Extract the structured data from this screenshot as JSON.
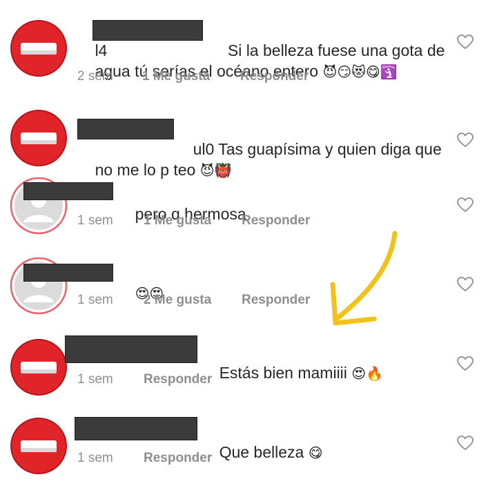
{
  "comments": [
    {
      "username_visible": "l4",
      "text_lines": [
        "Si la belleza fuese una gota de",
        "agua tú serías el océano entero"
      ],
      "emoji": "😈😏😻😋🛐",
      "time": "2 sem",
      "likes": "1 Me gusta",
      "reply": "Responder",
      "avatar": "no-entry-icon"
    },
    {
      "username_visible": "ul0",
      "text_lines": [
        "Tas guapísima y quien diga que",
        "no me lo p teo"
      ],
      "emoji": "😈👹",
      "avatar": "no-entry-icon"
    },
    {
      "text": "pero q hermosa",
      "time": "1 sem",
      "likes": "1 Me gusta",
      "reply": "Responder",
      "avatar": "default-user-avatar"
    },
    {
      "emoji": "😍😍",
      "time": "1 sem",
      "likes": "2 Me gusta",
      "reply": "Responder",
      "avatar": "default-user-avatar"
    },
    {
      "text": "Estás bien mamiiii",
      "emoji": "😍🔥",
      "time": "1 sem",
      "reply": "Responder",
      "avatar": "no-entry-icon"
    },
    {
      "text": "Que belleza",
      "emoji": "😋",
      "time": "1 sem",
      "reply": "Responder",
      "avatar": "no-entry-icon"
    }
  ],
  "colors": {
    "annotation_arrow": "#f2c21b",
    "no_entry_red": "#e0242a",
    "meta_gray": "#8e8e8e",
    "redaction": "#3b3b3b"
  }
}
